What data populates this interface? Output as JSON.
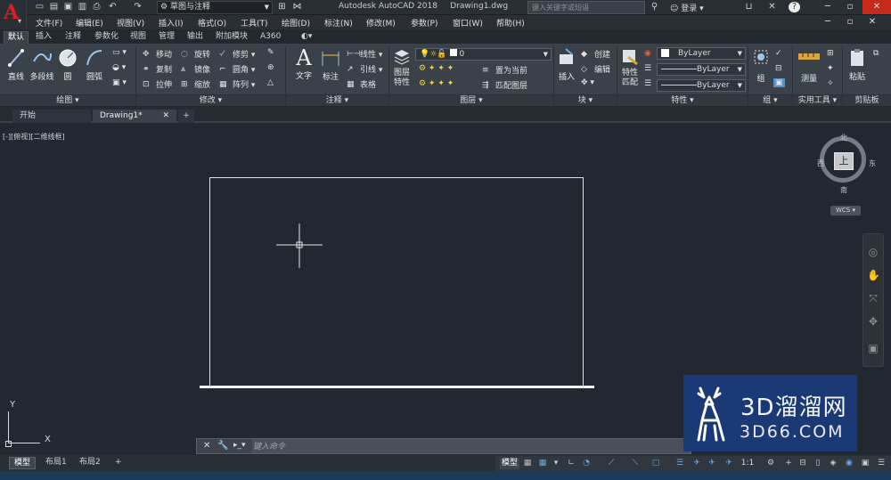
{
  "app": {
    "logo_letter": "A",
    "title": "Autodesk AutoCAD 2018",
    "filename": "Drawing1.dwg",
    "workspace": "草图与注释",
    "search_placeholder": "键入关键字或短语",
    "login": "登录"
  },
  "menus": [
    "文件(F)",
    "编辑(E)",
    "视图(V)",
    "插入(I)",
    "格式(O)",
    "工具(T)",
    "绘图(D)",
    "标注(N)",
    "修改(M)",
    "参数(P)",
    "窗口(W)",
    "帮助(H)"
  ],
  "ribbon_tabs": [
    "默认",
    "插入",
    "注释",
    "参数化",
    "视图",
    "管理",
    "输出",
    "附加模块",
    "A360"
  ],
  "draw_panel": {
    "big": [
      "直线",
      "多段线",
      "圆",
      "圆弧"
    ],
    "label": "绘图"
  },
  "modify_panel": {
    "items": [
      "移动",
      "旋转",
      "修剪",
      "复制",
      "镜像",
      "圆角",
      "拉伸",
      "缩放",
      "阵列"
    ],
    "label": "修改"
  },
  "annotation_panel": {
    "big": [
      "文字",
      "标注"
    ],
    "small": [
      "线性",
      "引线",
      "表格"
    ],
    "label": "注释"
  },
  "layers_panel": {
    "big": "图层特性",
    "layer_value": "0",
    "small": [
      "置为当前",
      "匹配图层"
    ],
    "label": "图层"
  },
  "block_panel": {
    "big": "插入",
    "small": [
      "创建",
      "编辑"
    ],
    "label": "块"
  },
  "properties_panel": {
    "big": "特性匹配",
    "combos": [
      "ByLayer",
      "ByLayer",
      "ByLayer"
    ],
    "label": "特性"
  },
  "groups_panel": {
    "big": "组",
    "label": "组"
  },
  "utilities_panel": {
    "big": "测量",
    "label": "实用工具"
  },
  "clipboard_panel": {
    "big": "粘贴",
    "label": "剪贴板"
  },
  "file_tabs": [
    "开始",
    "Drawing1*"
  ],
  "viewport_label": "[-][俯视][二维线框]",
  "viewcube": {
    "top": "上",
    "north": "北",
    "south": "南",
    "east": "东",
    "west": "西",
    "wcs": "WCS"
  },
  "ucs": {
    "x": "X",
    "y": "Y"
  },
  "command": {
    "placeholder": "键入命令"
  },
  "layout_tabs": [
    "模型",
    "布局1",
    "布局2"
  ],
  "status": {
    "model": "模型",
    "scale": "1:1"
  },
  "watermark": {
    "line1": "3D溜溜网",
    "line2": "3D66.COM"
  }
}
